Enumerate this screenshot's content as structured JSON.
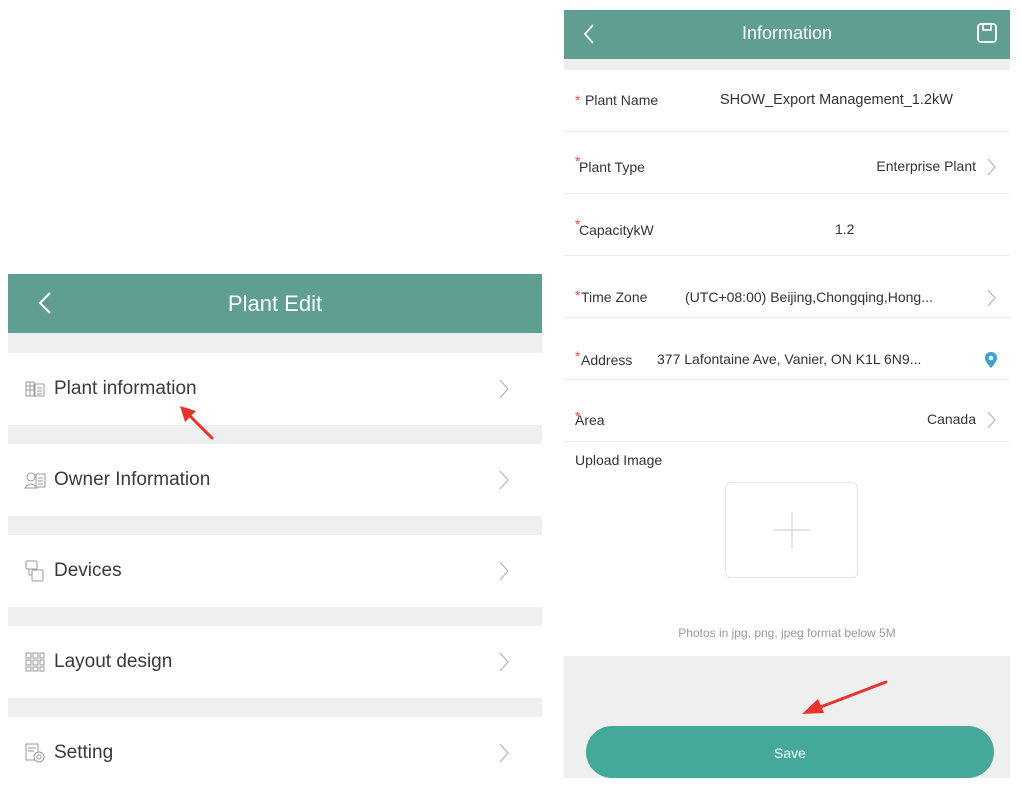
{
  "plant_edit": {
    "title": "Plant Edit",
    "items": [
      {
        "label": "Plant information",
        "icon": "plant-info-icon"
      },
      {
        "label": "Owner Information",
        "icon": "owner-icon"
      },
      {
        "label": "Devices",
        "icon": "devices-icon"
      },
      {
        "label": "Layout design",
        "icon": "layout-icon"
      },
      {
        "label": "Setting",
        "icon": "setting-icon"
      }
    ]
  },
  "information": {
    "title": "Information",
    "fields": {
      "plant_name": {
        "label": "Plant Name",
        "value": "SHOW_Export Management_1.2kW",
        "required": "*"
      },
      "plant_type": {
        "label": "Plant Type",
        "value": "Enterprise Plant",
        "required": "*"
      },
      "capacity": {
        "label": "CapacitykW",
        "value": "1.2",
        "required": "*"
      },
      "time_zone": {
        "label": "Time Zone",
        "value": "(UTC+08:00) Beijing,Chongqing,Hong...",
        "required": "*"
      },
      "address": {
        "label": "Address",
        "value": "377 Lafontaine Ave, Vanier, ON K1L 6N9...",
        "required": "*"
      },
      "area": {
        "label": "Area",
        "value": "Canada",
        "required": "*"
      }
    },
    "upload": {
      "label": "Upload Image",
      "hint": "Photos in jpg, png, jpeg format below 5M"
    },
    "save_label": "Save"
  },
  "colors": {
    "navbar": "#5f9e91",
    "save_button": "#45a999",
    "required": "#e0533f",
    "annotation_arrow": "#e8332a",
    "location_pin": "#3aa3d4"
  }
}
